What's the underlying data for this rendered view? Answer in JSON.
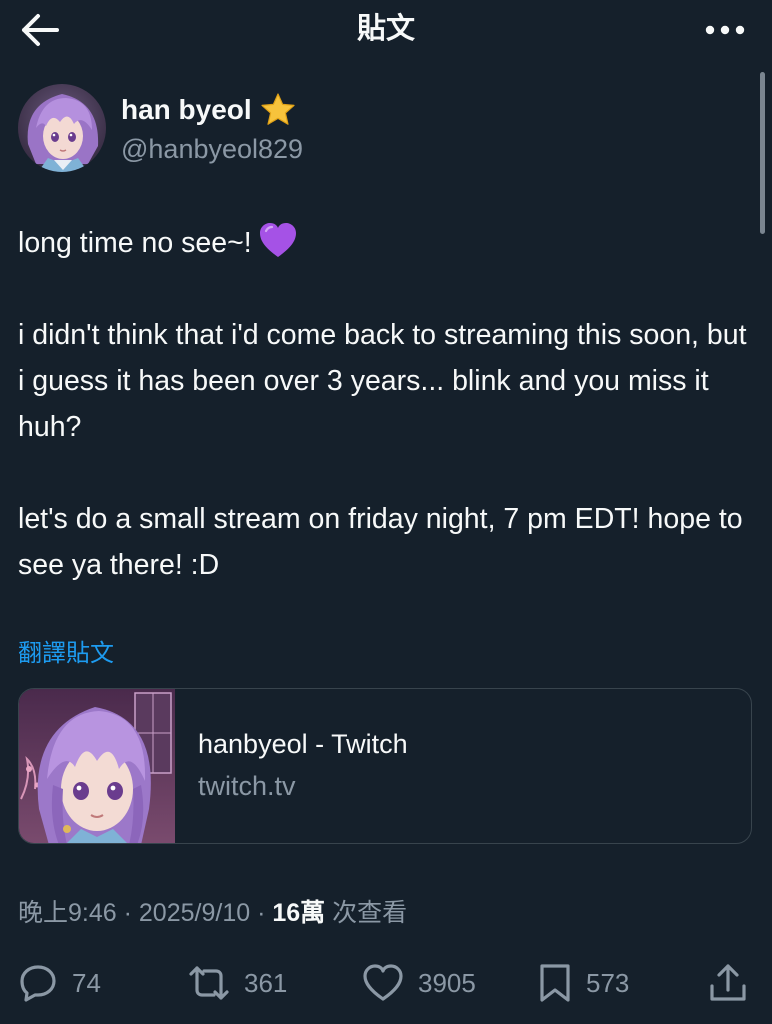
{
  "header": {
    "title": "貼文",
    "back_icon": "arrow-left-icon",
    "more_icon": "more-horizontal-icon"
  },
  "author": {
    "display_name": "han byeol",
    "badge_emoji": "star-icon",
    "handle": "@hanbyeol829"
  },
  "tweet": {
    "paragraphs": [
      "long time no see~!",
      "i didn't think that i'd come back to streaming this soon, but i guess it has been over 3 years... blink and you miss it huh?",
      "let's do a small stream on friday night, 7 pm EDT! hope to see ya there! :D"
    ],
    "first_paragraph_emoji": "purple-heart-icon"
  },
  "translate_label": "翻譯貼文",
  "link_card": {
    "title": "hanbyeol - Twitch",
    "domain": "twitch.tv"
  },
  "meta": {
    "time": "晚上9:46",
    "separator": "·",
    "date": "2025/9/10",
    "views_count": "16萬",
    "views_label": "次查看"
  },
  "actions": {
    "replies": "74",
    "reposts": "361",
    "likes": "3905",
    "bookmarks": "573"
  },
  "colors": {
    "background": "#15202b",
    "text": "#f7f9f9",
    "secondary": "#8b98a5",
    "accent": "#1d9bf0",
    "border": "#38444d"
  }
}
